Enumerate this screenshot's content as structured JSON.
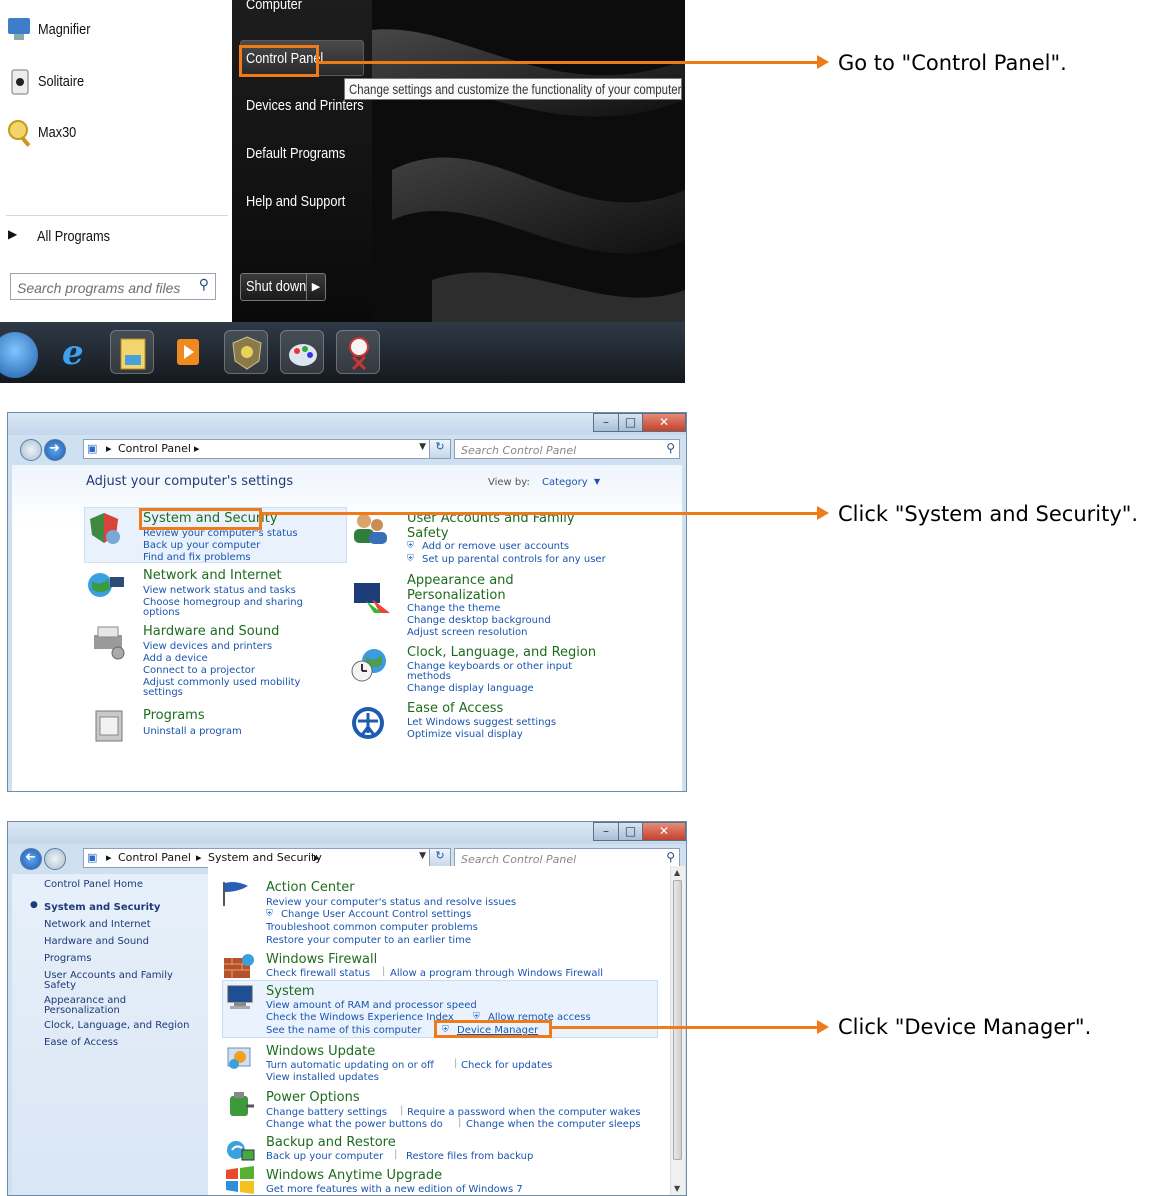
{
  "start_menu": {
    "programs": [
      {
        "label": "Magnifier",
        "icon": "magnifier-icon"
      },
      {
        "label": "Solitaire",
        "icon": "solitaire-icon"
      },
      {
        "label": "Max30",
        "icon": "max30-icon"
      }
    ],
    "all_programs": "All Programs",
    "search_placeholder": "Search programs and files",
    "right_items": [
      "Computer",
      "Control Panel",
      "Devices and Printers",
      "Default Programs",
      "Help and Support"
    ],
    "shutdown": "Shut down",
    "tooltip": "Change settings and customize the functionality of your computer.",
    "taskbar_icons": [
      "windows-orb-icon",
      "internet-explorer-icon",
      "file-manager-icon",
      "media-player-icon",
      "security-shield-icon",
      "paint-icon",
      "snipping-tool-icon"
    ]
  },
  "annotations": [
    "Go to \"Control Panel\".",
    "Click \"System and Security\".",
    "Click \"Device Manager\"."
  ],
  "window1": {
    "breadcrumb": [
      "Control Panel"
    ],
    "search_placeholder": "Search Control Panel",
    "title": "Adjust your computer's settings",
    "view_by_label": "View by:",
    "view_by_value": "Category",
    "categories": [
      {
        "name": "System and Security",
        "links": [
          "Review your computer's status",
          "Back up your computer",
          "Find and fix problems"
        ]
      },
      {
        "name": "Network and Internet",
        "links": [
          "View network status and tasks",
          "Choose homegroup and sharing",
          "options"
        ]
      },
      {
        "name": "Hardware and Sound",
        "links": [
          "View devices and printers",
          "Add a device",
          "Connect to a projector",
          "Adjust commonly used mobility",
          "settings"
        ]
      },
      {
        "name": "Programs",
        "links": [
          "Uninstall a program"
        ]
      },
      {
        "name_lines": [
          "User Accounts and Family",
          "Safety"
        ],
        "links": [
          "Add or remove user accounts",
          "Set up parental controls for any user"
        ]
      },
      {
        "name_lines": [
          "Appearance and",
          "Personalization"
        ],
        "links": [
          "Change the theme",
          "Change desktop background",
          "Adjust screen resolution"
        ]
      },
      {
        "name": "Clock, Language, and Region",
        "links": [
          "Change keyboards or other input",
          "methods",
          "Change display language"
        ]
      },
      {
        "name": "Ease of Access",
        "links": [
          "Let Windows suggest settings",
          "Optimize visual display"
        ]
      }
    ]
  },
  "window2": {
    "breadcrumb": [
      "Control Panel",
      "System and Security"
    ],
    "search_placeholder": "Search Control Panel",
    "sidebar": {
      "home": "Control Panel Home",
      "items": [
        "System and Security",
        "Network and Internet",
        "Hardware and Sound",
        "Programs",
        "User Accounts and Family",
        "Safety",
        "Appearance and",
        "Personalization",
        "Clock, Language, and Region",
        "Ease of Access"
      ]
    },
    "sections": [
      {
        "name": "Action Center",
        "rows": [
          [
            "Review your computer's status and resolve issues"
          ],
          [
            "Change User Account Control settings"
          ],
          [
            "Troubleshoot common computer problems"
          ],
          [
            "Restore your computer to an earlier time"
          ]
        ]
      },
      {
        "name": "Windows Firewall",
        "rows": [
          [
            "Check firewall status",
            "Allow a program through Windows Firewall"
          ]
        ]
      },
      {
        "name": "System",
        "rows": [
          [
            "View amount of RAM and processor speed"
          ],
          [
            "Check the Windows Experience Index",
            "Allow remote access"
          ],
          [
            "See the name of this computer",
            "Device Manager"
          ]
        ]
      },
      {
        "name": "Windows Update",
        "rows": [
          [
            "Turn automatic updating on or off",
            "Check for updates"
          ],
          [
            "View installed updates"
          ]
        ]
      },
      {
        "name": "Power Options",
        "rows": [
          [
            "Change battery settings",
            "Require a password when the computer wakes"
          ],
          [
            "Change what the power buttons do",
            "Change when the computer sleeps"
          ]
        ]
      },
      {
        "name": "Backup and Restore",
        "rows": [
          [
            "Back up your computer",
            "Restore files from backup"
          ]
        ]
      },
      {
        "name": "Windows Anytime Upgrade",
        "rows": [
          [
            "Get more features with a new edition of Windows 7"
          ]
        ]
      }
    ]
  }
}
